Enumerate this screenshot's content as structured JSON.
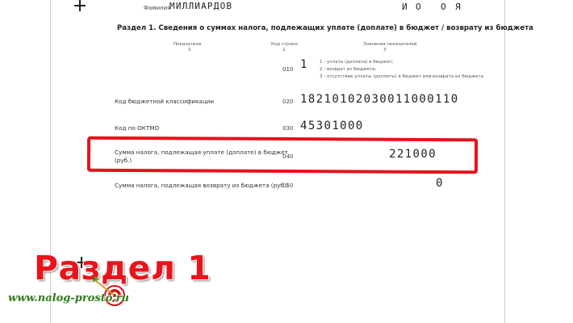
{
  "header": {
    "surname_label": "Фамилия",
    "surname_value": "МИЛЛИАРДОВ",
    "initial_i": "И",
    "initial_o": "О",
    "initial_o2": "О",
    "initial_ya": "Я"
  },
  "section": {
    "title": "Раздел 1. Сведения о суммах налога, подлежащих уплате (доплате) в бюджет / возврату из бюджета",
    "col_indicators": "Показатели",
    "col_indicators_num": "1",
    "col_code": "Код строки",
    "col_code_num": "2",
    "col_values": "Значения показателей",
    "col_values_num": "3"
  },
  "rows": {
    "r010": {
      "code": "010",
      "value": "1",
      "option_1": "1 - уплата (доплата) в бюджет;",
      "option_2": "2 - возврат из бюджета;",
      "option_3": "3 - отсутствие уплаты (доплаты) в бюджет или возврата из бюджета"
    },
    "r020": {
      "label": "Код бюджетной классификации",
      "code": "020",
      "value": "18210102030011000110"
    },
    "r030": {
      "label": "Код по ОКТМО",
      "code": "030",
      "value": "45301000"
    },
    "r040": {
      "label_line1": "Сумма налога, подлежащая уплате (доплате) в бюджет",
      "label_line2": "(руб.)",
      "code": "040",
      "value": "221000"
    },
    "r050": {
      "label": "Сумма налога, подлежащая возврату из бюджета (руб.)",
      "code": "050",
      "value": "0"
    }
  },
  "overlay": {
    "big_title": "Раздел 1",
    "site": "www.nalog-prosto.ru",
    "highlight_color": "#e3141b"
  }
}
